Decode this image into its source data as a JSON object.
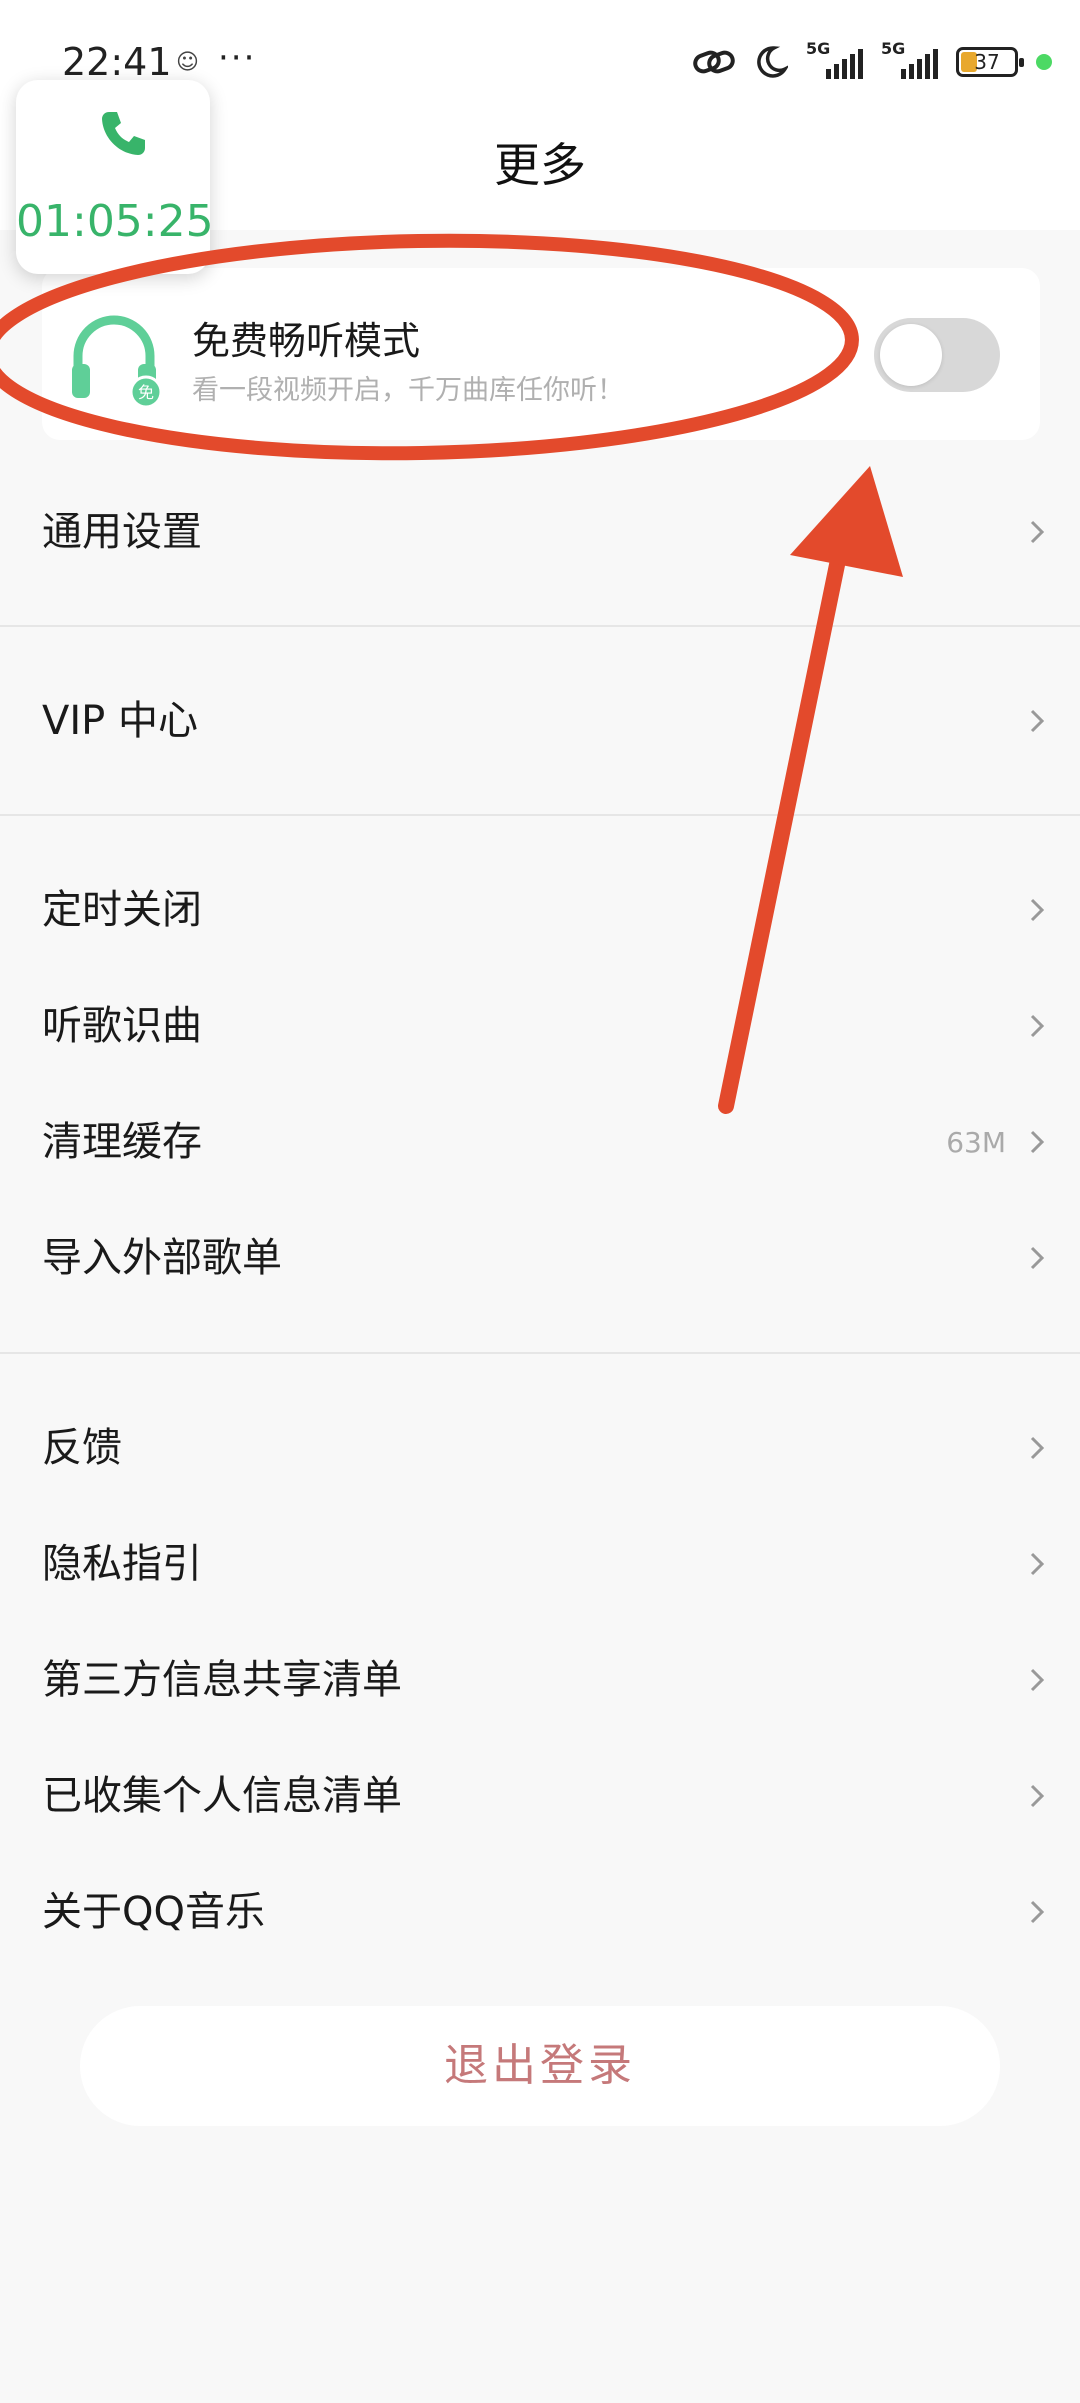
{
  "status_bar": {
    "time": "22:41",
    "network_label": "5G",
    "battery": "37",
    "icons": [
      "link-icon",
      "moon-icon",
      "signal-icon",
      "battery-icon"
    ]
  },
  "header": {
    "title": "更多"
  },
  "call_bubble": {
    "timer": "01:05:25",
    "icon": "phone-icon",
    "color": "#38b46a"
  },
  "free_mode": {
    "title": "免费畅听模式",
    "subtitle": "看一段视频开启，千万曲库任你听！",
    "badge": "免",
    "enabled": false,
    "icon": "headphone-icon",
    "accent": "#5fcf98"
  },
  "menu": {
    "general": "通用设置",
    "vip": "VIP 中心",
    "timer_off": "定时关闭",
    "song_recognition": "听歌识曲",
    "clear_cache": "清理缓存",
    "clear_cache_value": "63M",
    "import_playlist": "导入外部歌单",
    "feedback": "反馈",
    "privacy_guide": "隐私指引",
    "third_party_list": "第三方信息共享清单",
    "collected_info_list": "已收集个人信息清单",
    "about": "关于QQ音乐"
  },
  "logout": {
    "label": "退出登录",
    "color": "#c5797a"
  },
  "annotation": {
    "color": "#e34a2c"
  }
}
